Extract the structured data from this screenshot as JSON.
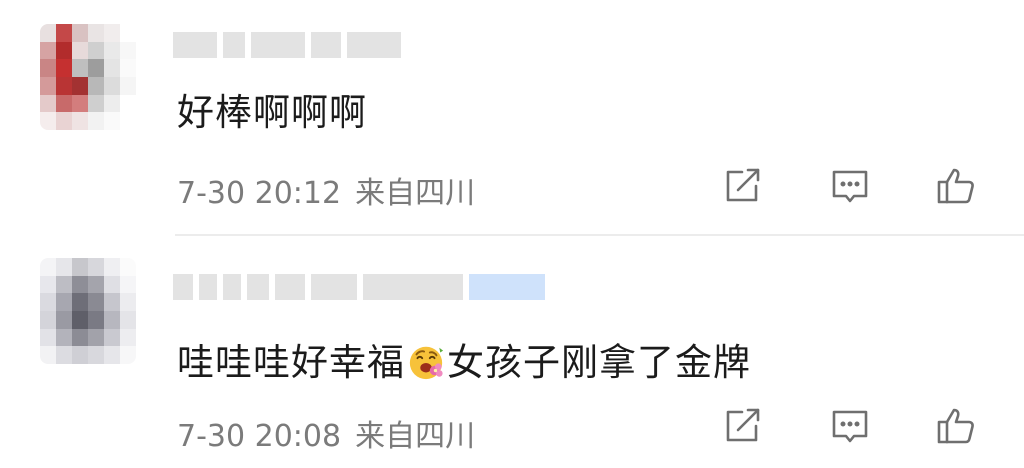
{
  "comments": [
    {
      "text": "好棒啊啊啊",
      "time": "7-30 20:12",
      "location": "来自四川",
      "avatar_colors": [
        "#e8e0e0",
        "#c44848",
        "#d9c2c2",
        "#e9e4e4",
        "#f1eded",
        "#ffffff",
        "#d6a3a3",
        "#b22c2c",
        "#e7dada",
        "#cfcfcf",
        "#e9e9e9",
        "#f7f7f7",
        "#c98585",
        "#c53030",
        "#bfbfbf",
        "#9d9d9d",
        "#e4e4e4",
        "#fafafa",
        "#d49a9a",
        "#b93434",
        "#a33232",
        "#b8b8b8",
        "#dcdcdc",
        "#f5f5f5",
        "#e4caca",
        "#c86a6a",
        "#d37d7d",
        "#cfcfcf",
        "#ededed",
        "#ffffff",
        "#f5eded",
        "#e9d3d3",
        "#efe3e3",
        "#f2f2f2",
        "#fafafa",
        "#ffffff"
      ]
    },
    {
      "text_before": "哇哇哇好幸福",
      "text_after": "女孩子刚拿了金牌",
      "emoji": "smiling-face-with-flower-icon",
      "time": "7-30 20:08",
      "location": "来自四川",
      "avatar_colors": [
        "#f4f4f6",
        "#e6e6ea",
        "#c7c7cc",
        "#d7d7dc",
        "#efeff2",
        "#fbfbfb",
        "#e7e7ec",
        "#bdbdc4",
        "#8e8e97",
        "#a4a4ac",
        "#dfdfe4",
        "#f5f5f7",
        "#dadae0",
        "#a7a7b0",
        "#6e6e78",
        "#8a8a93",
        "#c6c6cd",
        "#ececef",
        "#d4d4da",
        "#9a9aa3",
        "#5f5f69",
        "#7a7a84",
        "#b7b7bf",
        "#e4e4e8",
        "#e2e2e7",
        "#b3b3bb",
        "#8c8c95",
        "#a2a2aa",
        "#c9c9d0",
        "#ededf0",
        "#f2f2f4",
        "#dcdce1",
        "#cfcfd5",
        "#d8d8dd",
        "#e6e6ea",
        "#f7f7f8"
      ]
    }
  ],
  "colors": {
    "text": "#1b1b1b",
    "meta": "#7b7b7b",
    "icon": "#6f6f6f",
    "name_blur": "#e3e3e3",
    "name_blue": "#cfe2fb"
  },
  "icons": [
    "share-icon",
    "comment-icon",
    "like-icon"
  ]
}
